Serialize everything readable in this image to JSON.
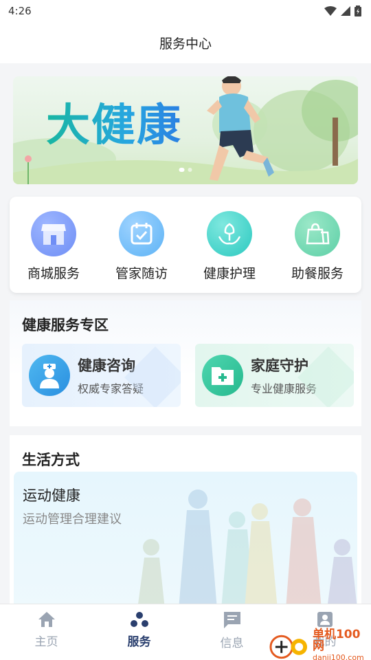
{
  "status_bar": {
    "time": "4:26"
  },
  "header": {
    "title": "服务中心"
  },
  "banner": {
    "title": "大健康"
  },
  "quick_services": [
    {
      "label": "商城服务",
      "icon": "store-icon",
      "color": "#6f8ef5"
    },
    {
      "label": "管家随访",
      "icon": "calendar-check-icon",
      "color": "#5db3f5"
    },
    {
      "label": "健康护理",
      "icon": "flower-hands-icon",
      "color": "#2cc9c0"
    },
    {
      "label": "助餐服务",
      "icon": "bags-icon",
      "color": "#5ccfa6"
    }
  ],
  "health_section": {
    "title": "健康服务专区",
    "cards": [
      {
        "title": "健康咨询",
        "subtitle": "权威专家答疑",
        "icon": "doctor-icon"
      },
      {
        "title": "家庭守护",
        "subtitle": "专业健康服务",
        "icon": "medical-folder-icon"
      }
    ]
  },
  "life_section": {
    "title": "生活方式",
    "card": {
      "title": "运动健康",
      "subtitle": "运动管理合理建议"
    }
  },
  "bottom_nav": [
    {
      "label": "主页",
      "icon": "home-icon",
      "active": false
    },
    {
      "label": "服务",
      "icon": "services-icon",
      "active": true
    },
    {
      "label": "信息",
      "icon": "message-icon",
      "active": false
    },
    {
      "label": "我的",
      "icon": "profile-icon",
      "active": false
    }
  ],
  "watermark": {
    "name": "单机100网",
    "url": "danji100.com"
  },
  "colors": {
    "accent": "#2a3f6e",
    "nav_inactive": "#9aa4b2"
  }
}
